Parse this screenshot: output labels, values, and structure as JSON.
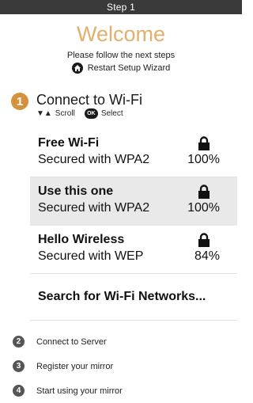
{
  "header": {
    "step_title": "Step 1"
  },
  "welcome": {
    "title": "Welcome",
    "instructions": "Please follow the next steps",
    "restart_label": "Restart Setup Wizard"
  },
  "current_step": {
    "number": "1",
    "title": "Connect to Wi-Fi",
    "hint_scroll_icons": "▼▲",
    "hint_scroll": "Scroll",
    "hint_ok_badge": "OK",
    "hint_select": "Select"
  },
  "networks": [
    {
      "name": "Free Wi-Fi",
      "security": "Secured with WPA2",
      "signal": "100%",
      "locked": true,
      "selected": false
    },
    {
      "name": "Use this one",
      "security": "Secured with WPA2",
      "signal": "100%",
      "locked": true,
      "selected": true
    },
    {
      "name": "Hello Wireless",
      "security": "Secured with WEP",
      "signal": "84%",
      "locked": true,
      "selected": false
    }
  ],
  "search": {
    "label": "Search for Wi-Fi Networks..."
  },
  "upcoming_steps": [
    {
      "number": "2",
      "label": "Connect to Server"
    },
    {
      "number": "3",
      "label": "Register your mirror"
    },
    {
      "number": "4",
      "label": "Start using your mirror"
    }
  ],
  "colors": {
    "accent": "#e4ae6c",
    "step_badge": "#d4923c",
    "topbar": "#3a3a3a",
    "selected_row": "#e9e9e9"
  },
  "icons": {
    "restart": "home-icon",
    "network_lock": "lock-icon",
    "ok_button": "ok-badge-icon"
  }
}
